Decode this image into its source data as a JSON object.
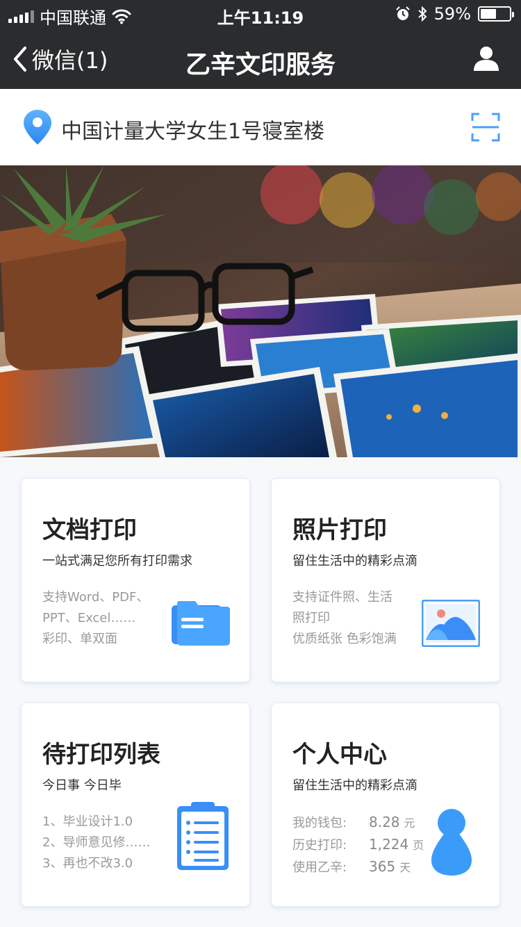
{
  "status_bar": {
    "carrier": "中国联通",
    "time": "上午11:19",
    "battery": "59%",
    "battery_level": 0.59
  },
  "nav": {
    "back_label": "微信(1)",
    "title": "乙辛文印服务"
  },
  "location": {
    "text": "中国计量大学女生1号寝室楼"
  },
  "cards": [
    {
      "title": "文档打印",
      "subtitle": "一站式满足您所有打印需求",
      "lines": [
        "支持Word、PDF、",
        "PPT、Excel……",
        "彩印、单双面"
      ],
      "icon": "folder-icon"
    },
    {
      "title": "照片打印",
      "subtitle": "留住生活中的精彩点滴",
      "lines": [
        "支持证件照、生活",
        "照打印",
        "优质纸张  色彩饱满"
      ],
      "icon": "image-icon"
    },
    {
      "title": "待打印列表",
      "subtitle": "今日事  今日毕",
      "lines": [
        "1、毕业设计1.0",
        "2、导师意见修……",
        "3、再也不改3.0"
      ],
      "icon": "clipboard-list-icon"
    },
    {
      "title": "个人中心",
      "subtitle": "留住生活中的精彩点滴",
      "stats": [
        {
          "label": "我的钱包:",
          "value": "8.28",
          "unit": "元"
        },
        {
          "label": "历史打印:",
          "value": "1,224",
          "unit": "页"
        },
        {
          "label": "使用乙辛:",
          "value": "365",
          "unit": "天"
        }
      ],
      "icon": "person-icon"
    }
  ],
  "colors": {
    "accent": "#4a9ff5",
    "header_bg": "#2b2c2e"
  }
}
